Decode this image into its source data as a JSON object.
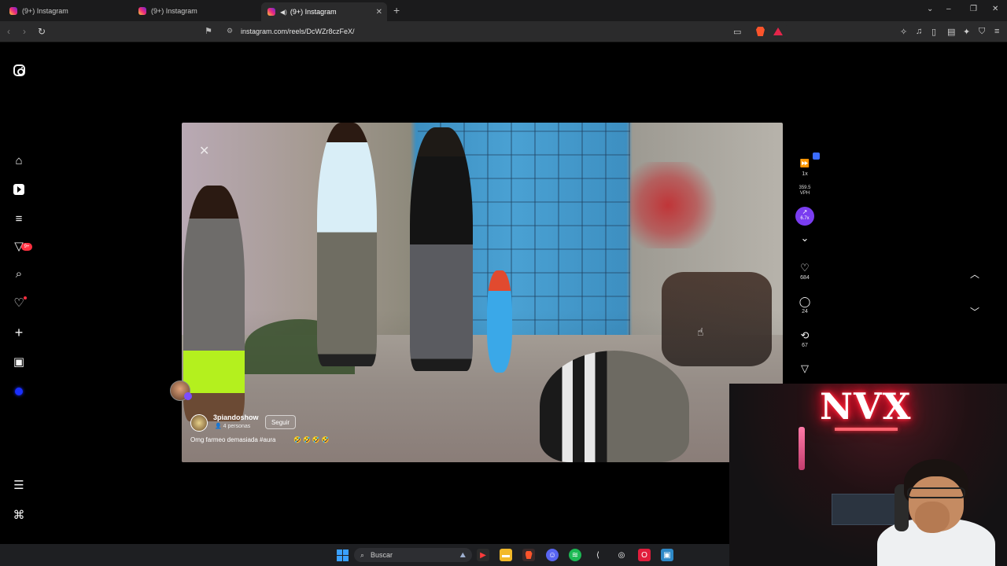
{
  "browser": {
    "tabs": [
      {
        "title": "(9+) Instagram",
        "active": false
      },
      {
        "title": "(9+) Instagram",
        "active": false
      },
      {
        "title": "(9+) Instagram",
        "active": true
      }
    ],
    "url": "instagram.com/reels/DcWZr8czFeX/"
  },
  "sidebar": {
    "items": [
      {
        "name": "instagram-logo-icon"
      },
      {
        "name": "home-icon"
      },
      {
        "name": "reels-icon"
      },
      {
        "name": "feed-filter-icon"
      },
      {
        "name": "messages-icon",
        "badge": "9+"
      },
      {
        "name": "search-icon"
      },
      {
        "name": "notifications-icon"
      },
      {
        "name": "create-icon"
      },
      {
        "name": "dashboard-icon"
      },
      {
        "name": "profile-icon"
      },
      {
        "name": "menu-icon"
      },
      {
        "name": "more-apps-icon"
      }
    ]
  },
  "reel": {
    "username": "3piandoshow",
    "persons": "4 personas",
    "follow_label": "Seguir",
    "caption": "Omg farmeo demasiada #aura",
    "emojis": "🤣🤣🤣🤣"
  },
  "actions": {
    "speed": "1x",
    "vph_value": "359.5",
    "vph_label": "VPH",
    "boost_value": "6.7x",
    "likes": "684",
    "comments": "24",
    "reposts": "67"
  },
  "webcam": {
    "neon_text": "NVX"
  },
  "taskbar": {
    "search_label": "Buscar"
  },
  "colors": {
    "accent_purple": "#7a3df0",
    "badge_red": "#ff3040",
    "neon_red": "#ff2a3d"
  }
}
